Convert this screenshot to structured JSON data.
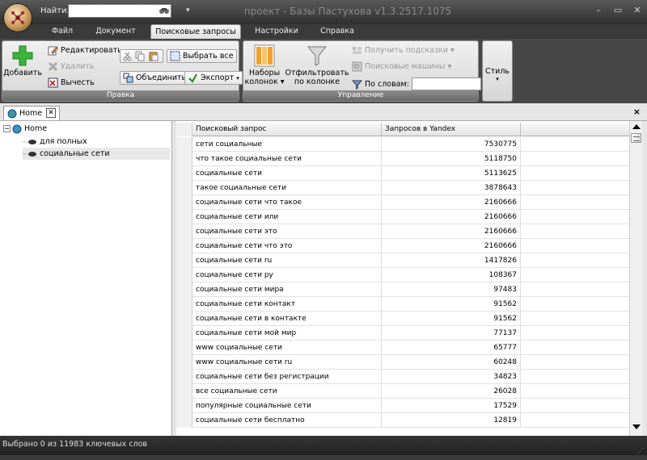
{
  "titlebar": {
    "find_label": "Найти:",
    "find_value": "",
    "app_title": "проект - Базы Пастухова v1.3.2517.1075",
    "quick_access_arrow": "▾",
    "controls": [
      "–",
      "▭",
      "✕"
    ]
  },
  "ribbon_tabs": [
    {
      "label": "Файл",
      "active": false
    },
    {
      "label": "Документ",
      "active": false
    },
    {
      "label": "Поисковые запросы",
      "active": true
    },
    {
      "label": "Настройки",
      "active": false
    },
    {
      "label": "Справка",
      "active": false
    }
  ],
  "ribbon": {
    "pravka": {
      "label": "Правка",
      "add": "Добавить",
      "edit": "Редактировать",
      "delete": "Удалить",
      "subtract": "Вычесть",
      "select_all": "Выбрать все",
      "merge": "Объединить",
      "export": "Экспорт"
    },
    "upravlenie": {
      "label": "Управление",
      "column_sets_1": "Наборы",
      "column_sets_2": "колонок ▾",
      "filter_1": "Отфильтровать",
      "filter_2": "по колонке",
      "get_hints": "Получить подсказки ▾",
      "search_engines": "Поисковые машины ▾",
      "by_words": "По словам:",
      "by_words_value": ""
    },
    "style": {
      "label_1": "Стиль",
      "label_2": "▾"
    }
  },
  "doc_tabs": {
    "home": "Home",
    "close": "✕",
    "close_all": "×"
  },
  "tree": {
    "root": "Home",
    "children": [
      "для полных",
      "социальные сети"
    ]
  },
  "grid": {
    "columns": [
      "Поисковый запрос",
      "Запросов в Yandex"
    ],
    "rows": [
      {
        "q": "сети социальные",
        "v": "7530775"
      },
      {
        "q": "что такое социальные сети",
        "v": "5118750"
      },
      {
        "q": "социальные сети",
        "v": "5113625"
      },
      {
        "q": "такое социальные сети",
        "v": "3878643"
      },
      {
        "q": "социальные сети что такое",
        "v": "2160666"
      },
      {
        "q": "социальные сети или",
        "v": "2160666"
      },
      {
        "q": "социальные сети это",
        "v": "2160666"
      },
      {
        "q": "социальные сети что это",
        "v": "2160666"
      },
      {
        "q": "социальные сети ru",
        "v": "1417826"
      },
      {
        "q": "социальные сети ру",
        "v": "108367"
      },
      {
        "q": "социальные сети мира",
        "v": "97483"
      },
      {
        "q": "социальные сети контакт",
        "v": "91562"
      },
      {
        "q": "социальные сети в контакте",
        "v": "91562"
      },
      {
        "q": "социальные сети мой мир",
        "v": "77137"
      },
      {
        "q": "www социальные сети",
        "v": "65777"
      },
      {
        "q": "www социальные сети ru",
        "v": "60248"
      },
      {
        "q": "социальные сети без регистрации",
        "v": "34823"
      },
      {
        "q": "все социальные сети",
        "v": "26028"
      },
      {
        "q": "популярные социальные сети",
        "v": "17529"
      },
      {
        "q": "социальные сети бесплатно",
        "v": "12819"
      }
    ]
  },
  "status": {
    "text": "Выбрано 0 из 11983 ключевых слов",
    "grip": "⋰"
  }
}
